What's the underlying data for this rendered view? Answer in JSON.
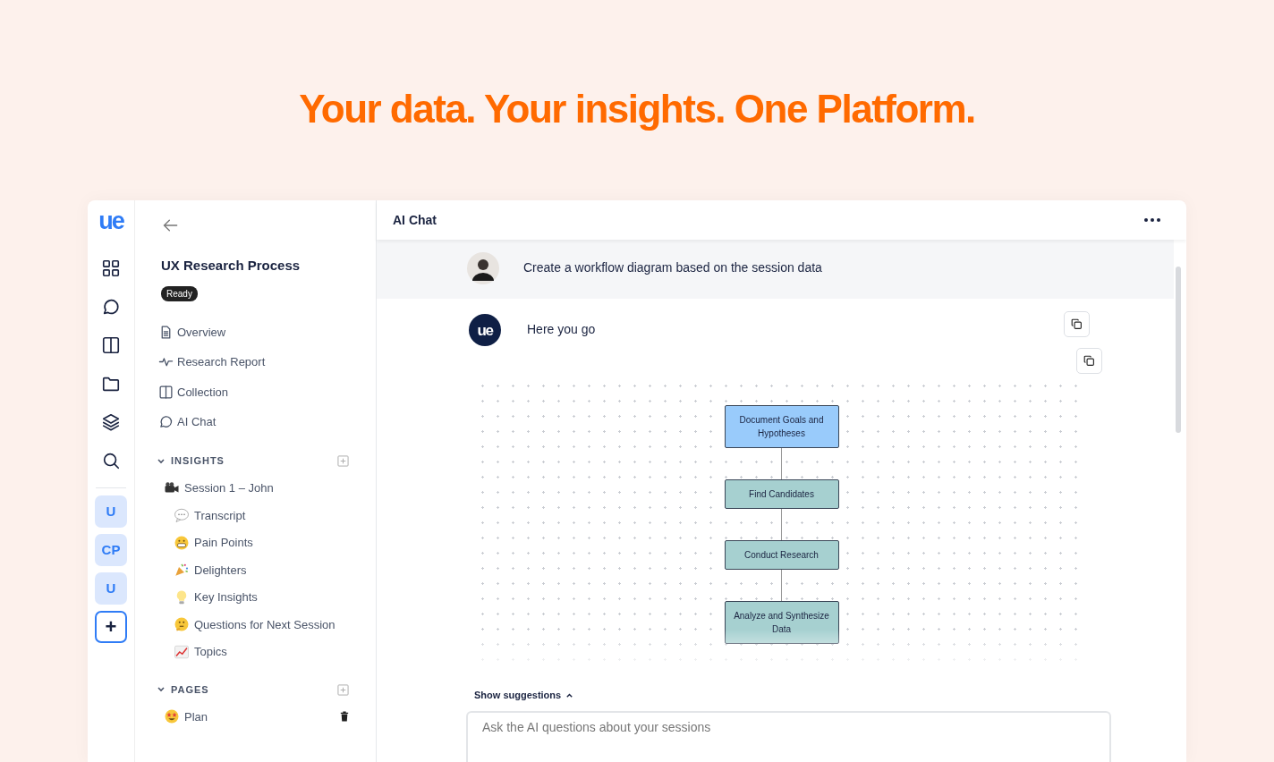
{
  "headline": "Your data. Your insights. One Platform.",
  "rail": {
    "logo": "ue",
    "nav": [
      {
        "kind": "grid"
      },
      {
        "kind": "chat"
      },
      {
        "kind": "columns"
      },
      {
        "kind": "folder"
      },
      {
        "kind": "layers"
      },
      {
        "kind": "search"
      }
    ],
    "workspaces": [
      "U",
      "CP",
      "U"
    ],
    "add": "+"
  },
  "sidebar": {
    "title": "UX Research Process",
    "status": "Ready",
    "nav": [
      {
        "kind": "doc",
        "label": "Overview"
      },
      {
        "kind": "pulse",
        "label": "Research Report"
      },
      {
        "kind": "columns",
        "label": "Collection"
      },
      {
        "kind": "chat",
        "label": "AI Chat"
      }
    ],
    "sections": [
      {
        "title": "INSIGHTS",
        "expanded": true,
        "items": [
          {
            "kind": "camera",
            "label": "Session 1 – John",
            "children": [
              {
                "kind": "speech",
                "label": "Transcript"
              },
              {
                "kind": "grimace",
                "label": "Pain Points"
              },
              {
                "kind": "party",
                "label": "Delighters"
              },
              {
                "kind": "bulb",
                "label": "Key Insights"
              },
              {
                "kind": "thinking",
                "label": "Questions for Next Session"
              },
              {
                "kind": "chart",
                "label": "Topics"
              }
            ]
          }
        ]
      },
      {
        "title": "PAGES",
        "expanded": true,
        "items": [
          {
            "kind": "starstruck",
            "label": "Plan",
            "deletable": true
          }
        ]
      }
    ]
  },
  "chat": {
    "title": "AI Chat",
    "messages": [
      {
        "kind": "user",
        "text": "Create a workflow diagram based on the session data"
      },
      {
        "kind": "assistant",
        "avatar": "ue",
        "text": "Here you go"
      }
    ],
    "diagram": {
      "nodes": [
        {
          "label": "Document Goals and Hypotheses",
          "selected": true
        },
        {
          "label": "Find Candidates",
          "selected": false
        },
        {
          "label": "Conduct Research",
          "selected": false
        },
        {
          "label": "Analyze and Synthesize Data",
          "selected": false
        }
      ]
    },
    "suggestions": "Show suggestions",
    "input": {
      "placeholder": "Ask the AI questions about your sessions"
    }
  }
}
